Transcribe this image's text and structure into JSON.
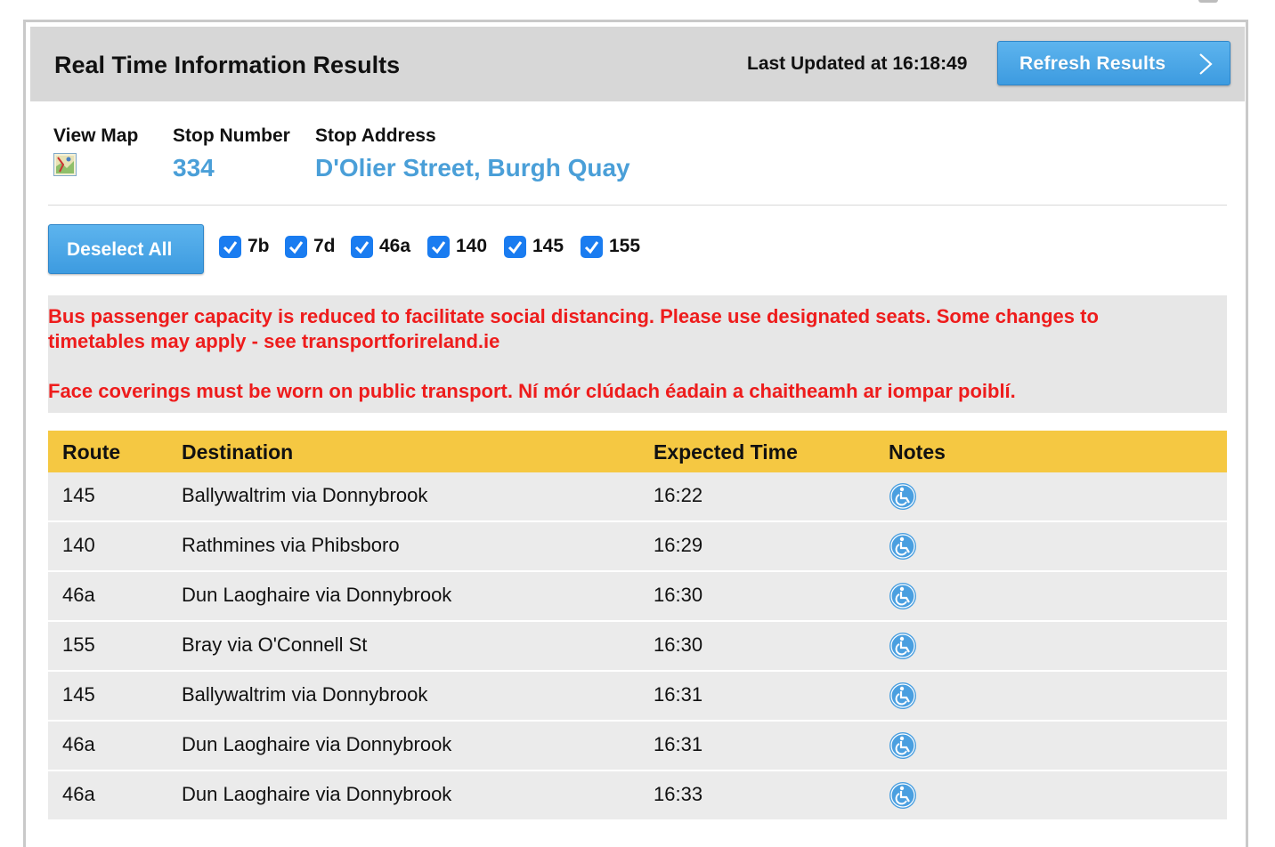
{
  "header": {
    "title": "Real Time Information Results",
    "last_updated": "Last Updated at 16:18:49",
    "refresh_label": "Refresh Results"
  },
  "stop": {
    "view_map_label": "View Map",
    "stop_number_label": "Stop Number",
    "stop_address_label": "Stop Address",
    "stop_number": "334",
    "stop_address": "D'Olier Street, Burgh Quay"
  },
  "filters": {
    "deselect_label": "Deselect All",
    "routes": [
      {
        "label": "7b",
        "checked": true
      },
      {
        "label": "7d",
        "checked": true
      },
      {
        "label": "46a",
        "checked": true
      },
      {
        "label": "140",
        "checked": true
      },
      {
        "label": "145",
        "checked": true
      },
      {
        "label": "155",
        "checked": true
      }
    ]
  },
  "notice": {
    "line1": "Bus passenger capacity is reduced to facilitate social distancing. Please use designated seats. Some changes to",
    "line2": "timetables may apply - see transportforireland.ie",
    "line3": "Face coverings must be worn on public transport. Ní mór clúdach éadain a chaitheamh ar iompar poiblí.",
    "color": "#ee1c1c"
  },
  "table": {
    "headers": {
      "route": "Route",
      "destination": "Destination",
      "expected": "Expected Time",
      "notes": "Notes"
    },
    "header_color": "#f5c842",
    "rows": [
      {
        "route": "145",
        "destination": "Ballywaltrim via Donnybrook",
        "time": "16:22",
        "note_icon": "wheelchair-accessible-icon"
      },
      {
        "route": "140",
        "destination": "Rathmines via Phibsboro",
        "time": "16:29",
        "note_icon": "wheelchair-accessible-icon"
      },
      {
        "route": "46a",
        "destination": "Dun Laoghaire via Donnybrook",
        "time": "16:30",
        "note_icon": "wheelchair-accessible-icon"
      },
      {
        "route": "155",
        "destination": "Bray via O'Connell St",
        "time": "16:30",
        "note_icon": "wheelchair-accessible-icon"
      },
      {
        "route": "145",
        "destination": "Ballywaltrim via Donnybrook",
        "time": "16:31",
        "note_icon": "wheelchair-accessible-icon"
      },
      {
        "route": "46a",
        "destination": "Dun Laoghaire via Donnybrook",
        "time": "16:31",
        "note_icon": "wheelchair-accessible-icon"
      },
      {
        "route": "46a",
        "destination": "Dun Laoghaire via Donnybrook",
        "time": "16:33",
        "note_icon": "wheelchair-accessible-icon"
      }
    ]
  }
}
